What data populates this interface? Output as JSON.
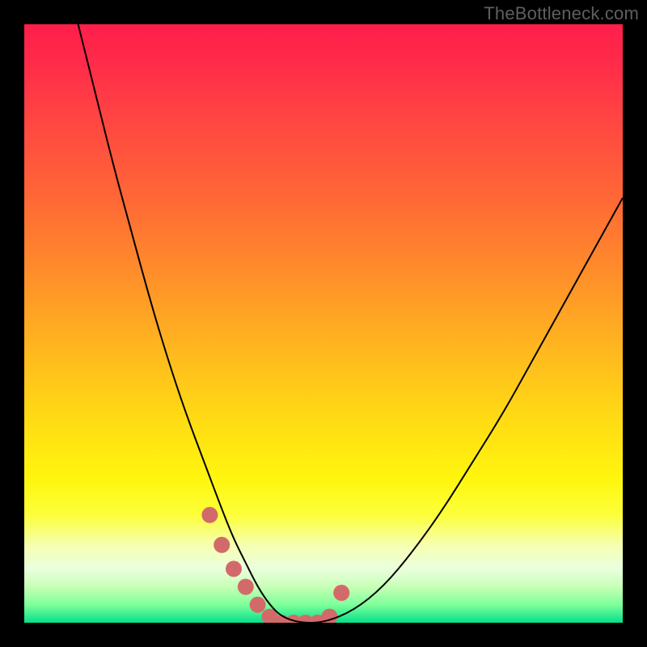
{
  "watermark": "TheBottleneck.com",
  "chart_data": {
    "type": "line",
    "title": "",
    "xlabel": "",
    "ylabel": "",
    "xlim": [
      0,
      100
    ],
    "ylim": [
      0,
      100
    ],
    "grid": false,
    "legend": false,
    "gradient_stops": [
      {
        "pos": 0,
        "color": "#ff1e4b"
      },
      {
        "pos": 6,
        "color": "#ff2a4a"
      },
      {
        "pos": 15,
        "color": "#ff4343"
      },
      {
        "pos": 30,
        "color": "#ff6a35"
      },
      {
        "pos": 42,
        "color": "#ff8f2a"
      },
      {
        "pos": 54,
        "color": "#ffb61f"
      },
      {
        "pos": 66,
        "color": "#ffdb14"
      },
      {
        "pos": 76,
        "color": "#fff60e"
      },
      {
        "pos": 82,
        "color": "#fcff3a"
      },
      {
        "pos": 87,
        "color": "#f6ffb0"
      },
      {
        "pos": 91,
        "color": "#eaffde"
      },
      {
        "pos": 94,
        "color": "#c7ffb6"
      },
      {
        "pos": 97,
        "color": "#7dff9a"
      },
      {
        "pos": 100,
        "color": "#04e08a"
      }
    ],
    "series": [
      {
        "name": "bottleneck-curve",
        "color": "#000000",
        "stroke_width": 2,
        "x": [
          9,
          12,
          15,
          18,
          21,
          24,
          27,
          30,
          33,
          35,
          37,
          39,
          41,
          43,
          46,
          50,
          55,
          60,
          65,
          70,
          75,
          80,
          85,
          90,
          95,
          100
        ],
        "y": [
          100,
          88,
          76,
          65,
          54,
          44,
          35,
          27,
          19,
          14,
          10,
          6,
          3,
          1,
          0,
          0,
          2,
          6,
          12,
          19,
          27,
          35,
          44,
          53,
          62,
          71
        ]
      }
    ],
    "marker_region": {
      "name": "highlight-dots",
      "color": "#d36a6a",
      "x": [
        31,
        33,
        35,
        37,
        39,
        41,
        43,
        45,
        47,
        49,
        51,
        53
      ],
      "y": [
        18,
        13,
        9,
        6,
        3,
        1,
        0,
        0,
        0,
        0,
        1,
        5
      ],
      "radius": 10
    }
  }
}
